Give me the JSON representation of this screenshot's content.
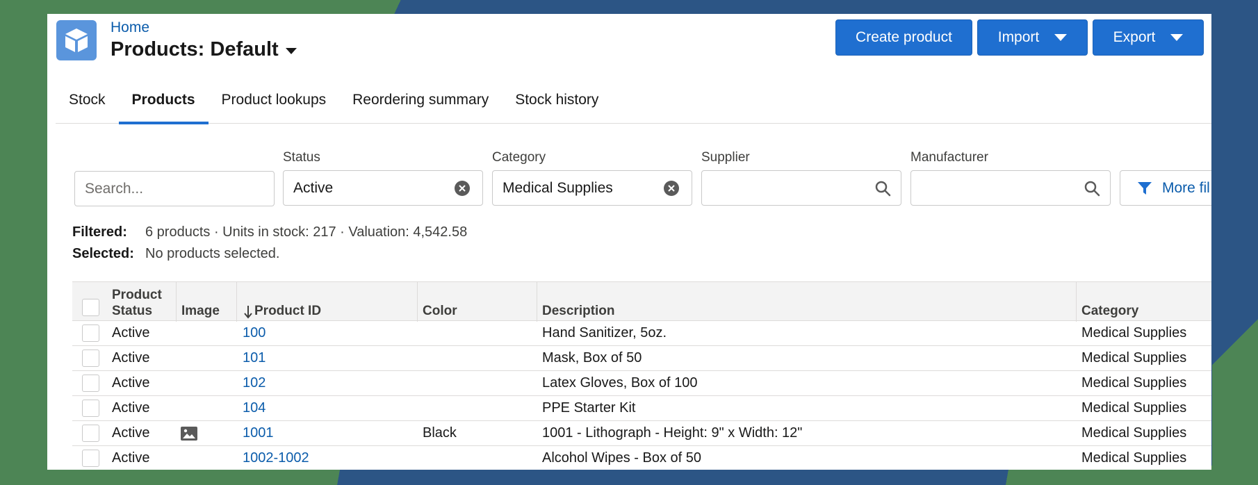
{
  "header": {
    "breadcrumb": "Home",
    "title": "Products: Default",
    "buttons": {
      "create": "Create product",
      "import": "Import",
      "export": "Export"
    }
  },
  "tabs": [
    {
      "label": "Stock",
      "active": false
    },
    {
      "label": "Products",
      "active": true
    },
    {
      "label": "Product lookups",
      "active": false
    },
    {
      "label": "Reordering summary",
      "active": false
    },
    {
      "label": "Stock history",
      "active": false
    }
  ],
  "filters": {
    "search_placeholder": "Search...",
    "status": {
      "label": "Status",
      "value": "Active"
    },
    "category": {
      "label": "Category",
      "value": "Medical Supplies"
    },
    "supplier": {
      "label": "Supplier",
      "value": ""
    },
    "manufacturer": {
      "label": "Manufacturer",
      "value": ""
    },
    "more_filters": "More fil"
  },
  "summary": {
    "filtered_label": "Filtered:",
    "filtered_value": "6 products · Units in stock: 217 · Valuation: 4,542.58",
    "selected_label": "Selected:",
    "selected_value": "No products selected."
  },
  "table": {
    "columns": {
      "status_line1": "Product",
      "status_line2": "Status",
      "image": "Image",
      "product_id": "Product ID",
      "color": "Color",
      "description": "Description",
      "category": "Category"
    },
    "rows": [
      {
        "status": "Active",
        "image": false,
        "id": "100",
        "color": "",
        "description": "Hand Sanitizer, 5oz.",
        "category": "Medical Supplies"
      },
      {
        "status": "Active",
        "image": false,
        "id": "101",
        "color": "",
        "description": "Mask, Box of 50",
        "category": "Medical Supplies"
      },
      {
        "status": "Active",
        "image": false,
        "id": "102",
        "color": "",
        "description": "Latex Gloves, Box of 100",
        "category": "Medical Supplies"
      },
      {
        "status": "Active",
        "image": false,
        "id": "104",
        "color": "",
        "description": "PPE Starter Kit",
        "category": "Medical Supplies"
      },
      {
        "status": "Active",
        "image": true,
        "id": "1001",
        "color": "Black",
        "description": "1001 - Lithograph - Height: 9\" x Width: 12\"",
        "category": "Medical Supplies"
      },
      {
        "status": "Active",
        "image": false,
        "id": "1002-1002",
        "color": "",
        "description": "Alcohol Wipes - Box of 50",
        "category": "Medical Supplies"
      }
    ]
  },
  "icons": {
    "app": "cube-icon",
    "clear": "clear-icon",
    "search": "search-icon",
    "filter": "filter-icon",
    "image": "image-icon",
    "sort": "sort-arrow-down-icon"
  },
  "colors": {
    "accent": "#1f6fd0",
    "link": "#0b5cab",
    "app_icon": "#5a95dc"
  }
}
